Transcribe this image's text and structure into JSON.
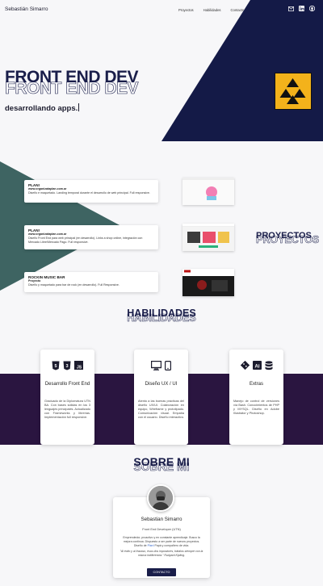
{
  "header": {
    "brand": "Sebastián Simarro",
    "nav": [
      "Proyectos",
      "Habilidades",
      "Contacto"
    ],
    "social_icons": [
      "mail-icon",
      "linkedin-icon",
      "github-icon"
    ]
  },
  "hero": {
    "title": "FRONT END DEV",
    "subtitle": "desarrollando apps.",
    "colors": {
      "navy": "#141a47",
      "accent": "#f3b21b"
    }
  },
  "projects": {
    "title": "PROYECTOS",
    "items": [
      {
        "name": "PLAN!",
        "url": "www.organizataplan.com.ar",
        "desc": "Diseño e maquetado. Landing temporal durante el desarrollo de web principal. Full responsive."
      },
      {
        "name": "PLAN!",
        "url": "www.organizataplan.com.ar",
        "desc": "Diseño Front End para web principal (en desarrollo). Links a shop online, integración con Mercado Libre/Mercado Pago. Full responsive."
      },
      {
        "name": "ROCKIN MUSIC BAR",
        "url": "Proyecto",
        "desc": "Diseño y maquetado para bar de rock (en desarrollo). Full Responsive."
      }
    ]
  },
  "skills": {
    "title": "HABILIDADES",
    "items": [
      {
        "name": "Desarrollo Front End",
        "icons": [
          "html5-icon",
          "css3-icon",
          "js-icon"
        ],
        "desc": "Graduado de la Diplomatura UTN BA. Con bases sólidas en los 3 lenguajes principales. Actualizado con Frameworks y librerías. Implementación full responsive."
      },
      {
        "name": "Diseño UX / UI",
        "icons": [
          "desktop-icon",
          "mobile-icon"
        ],
        "desc": "Atento a las buenas prácticas del diseño UX/UI. Colaboración en equipo, Wireframe y prototipado. Comunicación visual. Empatía con el usuario. Diseño interactivo."
      },
      {
        "name": "Extras",
        "icons": [
          "git-icon",
          "illustrator-icon",
          "database-icon"
        ],
        "desc": "Manejo de control de versiones vía Bash. Conocimientos de PHP y MYSQL. Diseño en Adobe Illustrator y Photoshop."
      }
    ]
  },
  "about": {
    "title": "SOBRE MI",
    "name": "Sebastian Simarro",
    "role": "Front End Developer (UTN)",
    "bio_1": "Emprendedor, proactivo y en constante aprendizaje. Busco la mejora continua. Dispuesto a ser parte de nuevos proyectos.",
    "bio_2_pre": "Diseño de ",
    "bio_2_link": "Plan!",
    "bio_2_post": " Papá y compañero de vida.",
    "quote": "\"Al éxito y al fracaso, esos dos impostores, trátalos siempre con la misma indiferencia.\" Rudyard Kipling.",
    "button": "CONTACTO"
  }
}
